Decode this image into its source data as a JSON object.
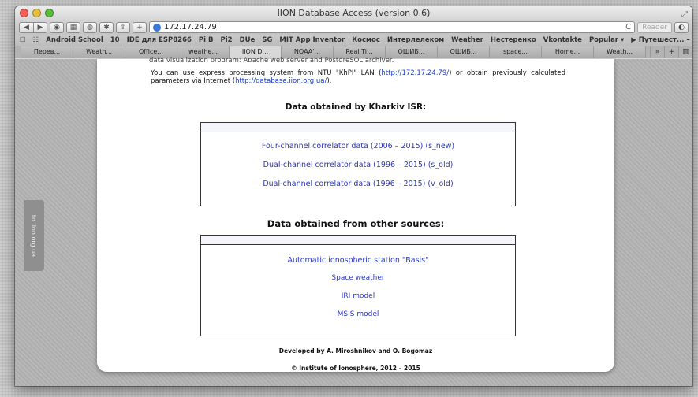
{
  "window": {
    "title": "IION Database Access (version 0.6)"
  },
  "toolbar": {
    "url": "172.17.24.79",
    "reader_label": "Reader",
    "add_label": "+",
    "reload_glyph": "C"
  },
  "bookmarks": [
    "Android School",
    "10",
    "IDE для ESP8266",
    "Pi B",
    "Pi2",
    "DUe",
    "SG",
    "MIT App Inventor",
    "Космос",
    "Интерлелеком",
    "Weather",
    "Нестеренко",
    "Vkontakte",
    "Popular ▾",
    "▶ Путешест... – YouTube"
  ],
  "tabs": [
    "Перев...",
    "Weath...",
    "Office...",
    "weathe...",
    "IION D...",
    "NOAA'...",
    "Real Ti...",
    "ОШИБ...",
    "ОШИБ...",
    "space...",
    "Home...",
    "Weath..."
  ],
  "sidebar_tab": {
    "label": "to iion.org.ua"
  },
  "page": {
    "cut_line": "data visualization program; Apache web server and PostgreSQL archiver.",
    "intro_text_1": "You can use express processing system from NTU \"KhPI\" LAN (",
    "intro_link_1": "http://172.17.24.79/",
    "intro_text_2": ") or obtain previously calculated parameters via Internet (",
    "intro_link_2": "http://database.iion.org.ua/",
    "intro_text_3": ").",
    "section_isr_title": "Data obtained by Kharkiv ISR:",
    "isr_links": [
      "Four-channel correlator data (2006 – 2015) (s_new)",
      "Dual-channel correlator data (1996 – 2015) (s_old)",
      "Dual-channel correlator data (1996 – 2015) (v_old)"
    ],
    "section_other_title": "Data obtained from other sources:",
    "other_links": [
      "Automatic ionospheric station \"Basis\"",
      "Space weather",
      "IRI model",
      "MSIS model"
    ],
    "credit_developed": "Developed by A. Miroshnikov and O. Bogomaz",
    "credit_copyright": "© Institute of Ionosphere, 2012 – 2015"
  }
}
